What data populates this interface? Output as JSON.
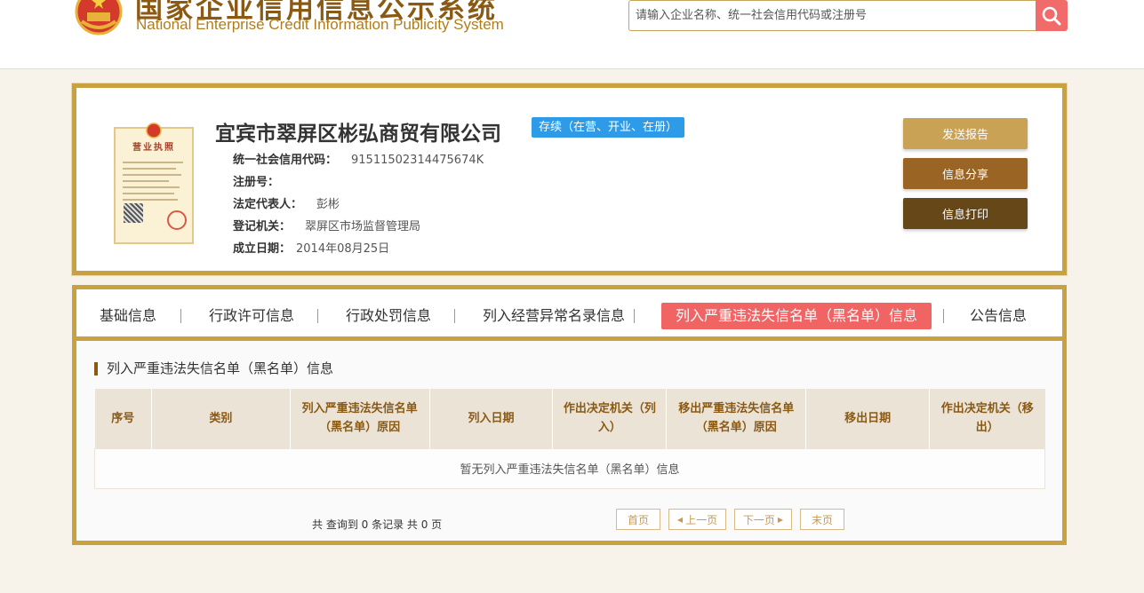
{
  "header": {
    "site_title_cn": "国家企业信用信息公示系统",
    "site_title_en": "National Enterprise Credit Information Publicity System",
    "search_placeholder": "请输入企业名称、统一社会信用代码或注册号"
  },
  "company": {
    "name": "宜宾市翠屏区彬弘商贸有限公司",
    "status": "存续（在营、开业、在册）",
    "license_title": "营业执照",
    "fields": [
      {
        "label": "统一社会信用代码：",
        "value": "91511502314475674K"
      },
      {
        "label": "注册号：",
        "value": ""
      },
      {
        "label": "法定代表人：",
        "value": "彭彬"
      },
      {
        "label": "登记机关：",
        "value": "翠屏区市场监督管理局"
      },
      {
        "label": "成立日期：",
        "value": "2014年08月25日"
      }
    ],
    "actions": [
      {
        "label": "发送报告",
        "color": "#c9a256"
      },
      {
        "label": "信息分享",
        "color": "#9a6524"
      },
      {
        "label": "信息打印",
        "color": "#664718"
      }
    ]
  },
  "tabs": [
    {
      "label": "基础信息"
    },
    {
      "label": "行政许可信息"
    },
    {
      "label": "行政处罚信息"
    },
    {
      "label": "列入经营异常名录信息"
    },
    {
      "label": "列入严重违法失信名单（黑名单）信息"
    },
    {
      "label": "公告信息"
    }
  ],
  "section": {
    "title": "列入严重违法失信名单（黑名单）信息",
    "columns": [
      "序号",
      "类别",
      "列入严重违法失信名单（黑名单）原因",
      "列入日期",
      "作出决定机关（列入）",
      "移出严重违法失信名单（黑名单）原因",
      "移出日期",
      "作出决定机关（移出）"
    ],
    "empty_text": "暂无列入严重违法失信名单（黑名单）信息"
  },
  "pagination": {
    "summary": "共 查询到 0 条记录 共 0 页",
    "first": "首页",
    "prev": "上一页",
    "next": "下一页",
    "last": "末页"
  },
  "colors": {
    "gold_border": "#c9a23f",
    "brown": "#8a5a14",
    "active_tab": "#f06464",
    "status_blue": "#2d9be8",
    "search_red": "#f26b6b"
  }
}
